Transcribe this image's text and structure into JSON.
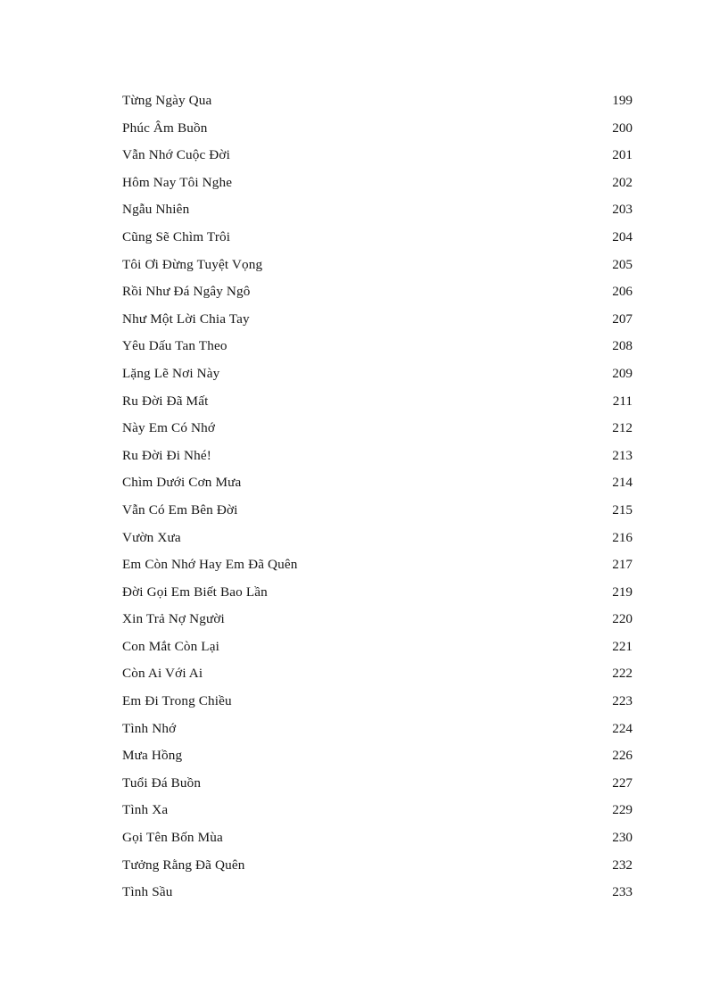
{
  "document": {
    "type": "table-of-contents",
    "page_background": "#ffffff",
    "text_color": "#161616"
  },
  "toc": {
    "entries": [
      {
        "title": "Từng Ngày Qua",
        "page": "199"
      },
      {
        "title": "Phúc Âm Buồn",
        "page": "200"
      },
      {
        "title": "Vẫn Nhớ Cuộc Đời",
        "page": "201"
      },
      {
        "title": "Hôm Nay Tôi Nghe",
        "page": "202"
      },
      {
        "title": "Ngẫu Nhiên",
        "page": "203"
      },
      {
        "title": "Cũng Sẽ Chìm Trôi",
        "page": "204"
      },
      {
        "title": "Tôi Ơi Đừng Tuyệt Vọng",
        "page": "205"
      },
      {
        "title": "Rồi Như Đá Ngây Ngô",
        "page": "206"
      },
      {
        "title": "Như Một Lời Chia Tay",
        "page": "207"
      },
      {
        "title": "Yêu Dấu Tan Theo",
        "page": "208"
      },
      {
        "title": "Lặng Lẽ Nơi Này",
        "page": "209"
      },
      {
        "title": "Ru Đời Đã Mất",
        "page": "211"
      },
      {
        "title": "Này Em Có Nhớ",
        "page": "212"
      },
      {
        "title": "Ru Đời Đi Nhé!",
        "page": "213"
      },
      {
        "title": "Chìm Dưới Cơn Mưa",
        "page": "214"
      },
      {
        "title": "Vẫn Có Em Bên Đời",
        "page": "215"
      },
      {
        "title": "Vườn Xưa",
        "page": "216"
      },
      {
        "title": "Em Còn Nhớ Hay Em Đã Quên",
        "page": "217"
      },
      {
        "title": "Đời Gọi Em Biết Bao Lần",
        "page": "219"
      },
      {
        "title": "Xin Trả Nợ Người",
        "page": "220"
      },
      {
        "title": "Con Mắt Còn Lại",
        "page": "221"
      },
      {
        "title": "Còn Ai Với Ai",
        "page": "222"
      },
      {
        "title": "Em Đi Trong Chiều",
        "page": "223"
      },
      {
        "title": "Tình Nhớ",
        "page": "224"
      },
      {
        "title": "Mưa Hồng",
        "page": "226"
      },
      {
        "title": "Tuổi Đá Buồn",
        "page": "227"
      },
      {
        "title": "Tình Xa",
        "page": "229"
      },
      {
        "title": "Gọi Tên Bốn Mùa",
        "page": "230"
      },
      {
        "title": "Tưởng Rằng Đã Quên",
        "page": "232"
      },
      {
        "title": "Tình Sầu",
        "page": "233"
      }
    ]
  }
}
